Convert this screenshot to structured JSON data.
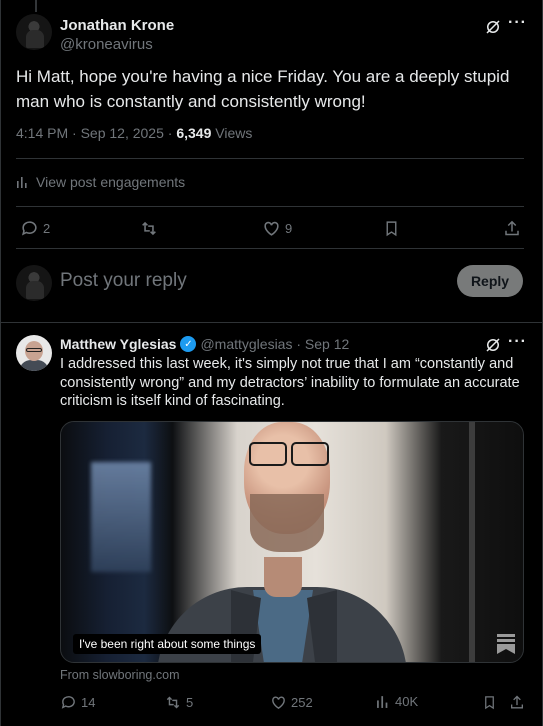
{
  "main_post": {
    "author_name": "Jonathan Krone",
    "author_handle": "@kroneavirus",
    "text": "Hi Matt, hope you're having a nice Friday. You are a deeply stupid man who is constantly and consistently wrong!",
    "time": "4:14 PM · Sep 12, 2025 · ",
    "views_count": "6,349",
    "views_label": "Views",
    "engagements_link": "View post engagements",
    "actions": {
      "reply_count": "2",
      "repost_count": "",
      "like_count": "9"
    }
  },
  "reply_composer": {
    "placeholder": "Post your reply",
    "button_label": "Reply"
  },
  "quoted_post": {
    "author_name": "Matthew Yglesias",
    "author_handle": "@mattyglesias · Sep 12",
    "text": "I addressed this last week, it's simply not true that I am “constantly and consistently wrong” and my detractors’ inability to formulate an accurate criticism is itself kind of fascinating.",
    "media_caption": "I've been right about some things",
    "source": "From slowboring.com",
    "actions": {
      "reply_count": "14",
      "repost_count": "5",
      "like_count": "252",
      "views_count": "40K"
    }
  },
  "colors": {
    "background": "#000000",
    "text_primary": "#e7e9ea",
    "text_secondary": "#71767b",
    "divider": "#2f3336",
    "verified": "#1d9bf0",
    "reply_button": "#787a7a"
  }
}
